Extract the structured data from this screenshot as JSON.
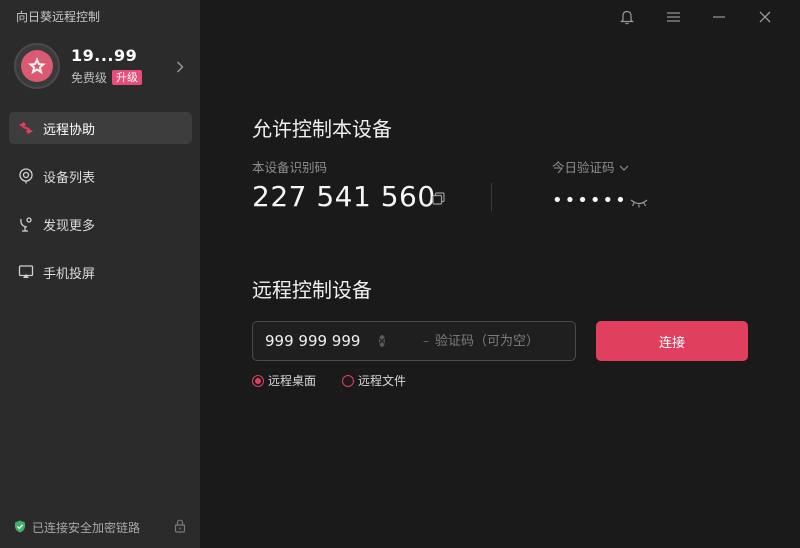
{
  "app": {
    "title": "向日葵远程控制"
  },
  "profile": {
    "name": "19...99",
    "tier": "免费级",
    "upgrade_label": "升级"
  },
  "nav": {
    "items": [
      {
        "label": "远程协助",
        "icon": "remote-assist-icon",
        "active": true
      },
      {
        "label": "设备列表",
        "icon": "device-list-icon",
        "active": false
      },
      {
        "label": "发现更多",
        "icon": "discover-icon",
        "active": false
      },
      {
        "label": "手机投屏",
        "icon": "screen-mirror-icon",
        "active": false
      }
    ]
  },
  "footer": {
    "status": "已连接安全加密链路"
  },
  "allow": {
    "title": "允许控制本设备",
    "id_label": "本设备识别码",
    "device_id": "227 541 560",
    "verify_label": "今日验证码",
    "verify_code": "••••••"
  },
  "remote": {
    "title": "远程控制设备",
    "id_value": "999 999 999",
    "code_placeholder": "验证码（可为空）",
    "connect_label": "连接",
    "modes": [
      {
        "label": "远程桌面",
        "selected": true
      },
      {
        "label": "远程文件",
        "selected": false
      }
    ]
  },
  "colors": {
    "accent": "#e0405e",
    "badge": "#e84d79",
    "sidebar_bg": "#2b2b2b",
    "main_bg": "#1a1a1a"
  }
}
